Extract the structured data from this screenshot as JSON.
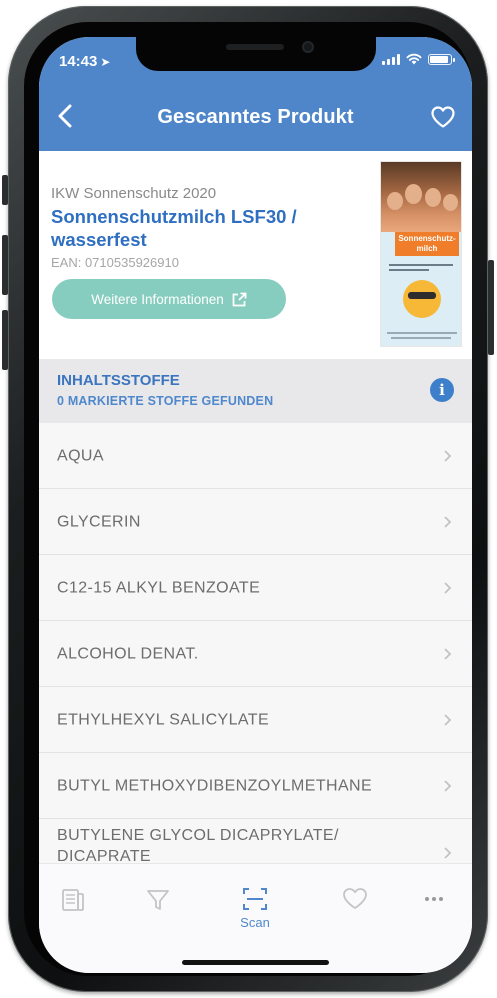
{
  "status_bar": {
    "time": "14:43"
  },
  "nav": {
    "title": "Gescanntes Produkt"
  },
  "product": {
    "brand": "IKW Sonnenschutz 2020",
    "name": "Sonnenschutzmilch LSF30 / wasserfest",
    "ean": "EAN: 0710535926910",
    "info_button": "Weitere Informationen",
    "image_text": "Sonnenschutz-milch"
  },
  "ingredients": {
    "title": "INHALTSSTOFFE",
    "subtitle": "0 MARKIERTE STOFFE GEFUNDEN",
    "items": [
      "AQUA",
      "GLYCERIN",
      "C12-15 ALKYL BENZOATE",
      "ALCOHOL DENAT.",
      "ETHYLHEXYL SALICYLATE",
      "BUTYL METHOXYDIBENZOYLMETHANE",
      "BUTYLENE GLYCOL DICAPRYLATE/ DICAPRATE"
    ]
  },
  "tabbar": {
    "scan_label": "Scan"
  },
  "colors": {
    "header": "#4e86c9",
    "accent": "#3b74bf",
    "info_button": "#86cdbf",
    "section_bg": "#e8e8ea"
  }
}
